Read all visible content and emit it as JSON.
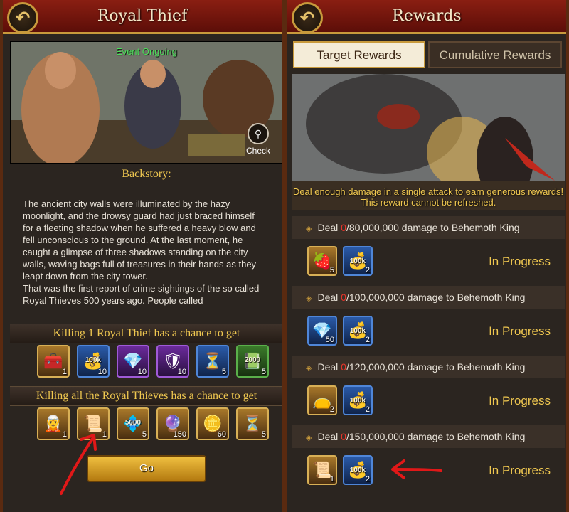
{
  "left": {
    "title": "Royal Thief",
    "event_status": "Event Ongoing",
    "check_label": "Check",
    "backstory_heading": "Backstory:",
    "backstory_paragraphs": [
      "The ancient city walls were illuminated by the hazy moonlight, and the drowsy guard had just braced himself for a fleeting shadow when he suffered a heavy blow and fell unconscious to the ground. At the last moment, he caught a glimpse of three shadows standing on the city walls, waving bags full of treasures in their hands as they leapt down from the city tower.",
      "That was the first report of crime sightings of the so called Royal Thieves 500 years ago. People called"
    ],
    "single_drop_heading": "Killing 1 Royal Thief has a chance to get",
    "single_drop_items": [
      {
        "icon": "treasure-chest-icon",
        "glyph": "🧰",
        "count": "1",
        "label": "",
        "frame": "gold"
      },
      {
        "icon": "gold-pile-icon",
        "glyph": "💰",
        "count": "10",
        "label": "100k",
        "frame": "blue"
      },
      {
        "icon": "gem-pile-icon",
        "glyph": "💎",
        "count": "10",
        "label": "",
        "frame": "purple"
      },
      {
        "icon": "badge-icon",
        "glyph": "🛡",
        "count": "10",
        "label": "",
        "frame": "purple"
      },
      {
        "icon": "hourglass-icon",
        "glyph": "⏳",
        "count": "5",
        "label": "",
        "frame": "blue"
      },
      {
        "icon": "exp-book-icon",
        "glyph": "📗",
        "count": "5",
        "label": "2000",
        "frame": "green"
      }
    ],
    "all_drop_heading": "Killing all the Royal Thieves has a chance to get",
    "all_drop_items": [
      {
        "icon": "hero-portrait-icon",
        "glyph": "🧝",
        "count": "1",
        "label": "",
        "frame": "gold"
      },
      {
        "icon": "scroll-item-icon",
        "glyph": "📜",
        "count": "1",
        "label": "",
        "frame": "gold"
      },
      {
        "icon": "gem-stack-icon",
        "glyph": "💠",
        "count": "5",
        "label": "5000",
        "frame": "gold"
      },
      {
        "icon": "crystal-icon",
        "glyph": "🔮",
        "count": "150",
        "label": "",
        "frame": "gold"
      },
      {
        "icon": "gold-coin-icon",
        "glyph": "🪙",
        "count": "60",
        "label": "",
        "frame": "gold"
      },
      {
        "icon": "hourglass-icon",
        "glyph": "⏳",
        "count": "5",
        "label": "",
        "frame": "gold"
      }
    ],
    "go_label": "Go"
  },
  "right": {
    "title": "Rewards",
    "tabs": [
      "Target Rewards",
      "Cumulative Rewards"
    ],
    "art_caption": "Deal enough damage in a single attack to earn generous rewards! This reward cannot be refreshed.",
    "tiers": [
      {
        "current": "0",
        "target": "/80,000,000 damage to Behemoth King",
        "status": "In Progress",
        "items": [
          {
            "icon": "strawberry-pack-icon",
            "glyph": "🍓",
            "count": "5",
            "label": "",
            "frame": "gold"
          },
          {
            "icon": "gold-pile-icon",
            "glyph": "💰",
            "count": "2",
            "label": "100k",
            "frame": "blue"
          }
        ]
      },
      {
        "current": "0",
        "target": "/100,000,000 damage to Behemoth King",
        "status": "In Progress",
        "items": [
          {
            "icon": "blue-crystal-icon",
            "glyph": "💎",
            "count": "50",
            "label": "",
            "frame": "blue"
          },
          {
            "icon": "gold-pile-icon",
            "glyph": "💰",
            "count": "2",
            "label": "100k",
            "frame": "blue"
          }
        ]
      },
      {
        "current": "0",
        "target": "/120,000,000 damage to Behemoth King",
        "status": "In Progress",
        "items": [
          {
            "icon": "treasure-bag-icon",
            "glyph": "👝",
            "count": "2",
            "label": "",
            "frame": "gold"
          },
          {
            "icon": "gold-pile-icon",
            "glyph": "💰",
            "count": "2",
            "label": "100k",
            "frame": "blue"
          }
        ]
      },
      {
        "current": "0",
        "target": "/150,000,000 damage to Behemoth King",
        "status": "In Progress",
        "items": [
          {
            "icon": "scroll-item-icon",
            "glyph": "📜",
            "count": "1",
            "label": "",
            "frame": "gold"
          },
          {
            "icon": "gold-pile-icon",
            "glyph": "💰",
            "count": "2",
            "label": "100k",
            "frame": "blue"
          }
        ]
      }
    ]
  },
  "colors": {
    "accent_gold": "#f0c850",
    "title_red": "#8a1e12",
    "status_green": "#4ce05a",
    "highlight_red": "#e8342a"
  }
}
